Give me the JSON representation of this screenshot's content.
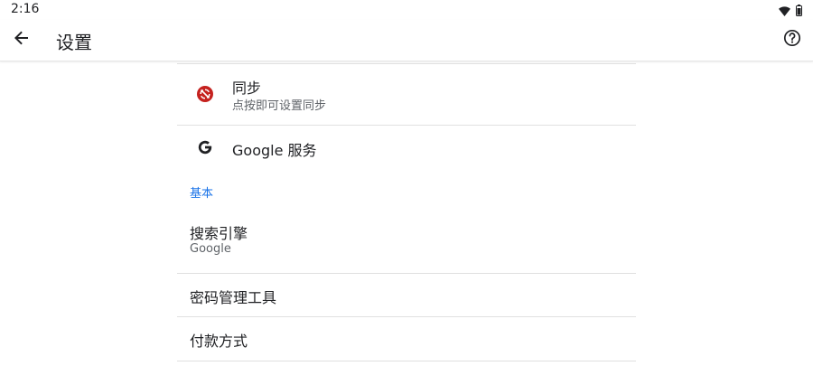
{
  "status": {
    "time": "2:16"
  },
  "header": {
    "title": "设置"
  },
  "sync": {
    "title": "同步",
    "subtitle": "点按即可设置同步"
  },
  "google_services": {
    "title": "Google 服务"
  },
  "basics": {
    "header": "基本",
    "search_engine": {
      "title": "搜索引擎",
      "subtitle": "Google"
    },
    "password_manager": {
      "title": "密码管理工具"
    },
    "payment_methods": {
      "title": "付款方式"
    }
  },
  "colors": {
    "accent": "#1a73e8",
    "sync_icon": "#c5221f",
    "text_primary": "#202124",
    "text_secondary": "#5f6368"
  }
}
